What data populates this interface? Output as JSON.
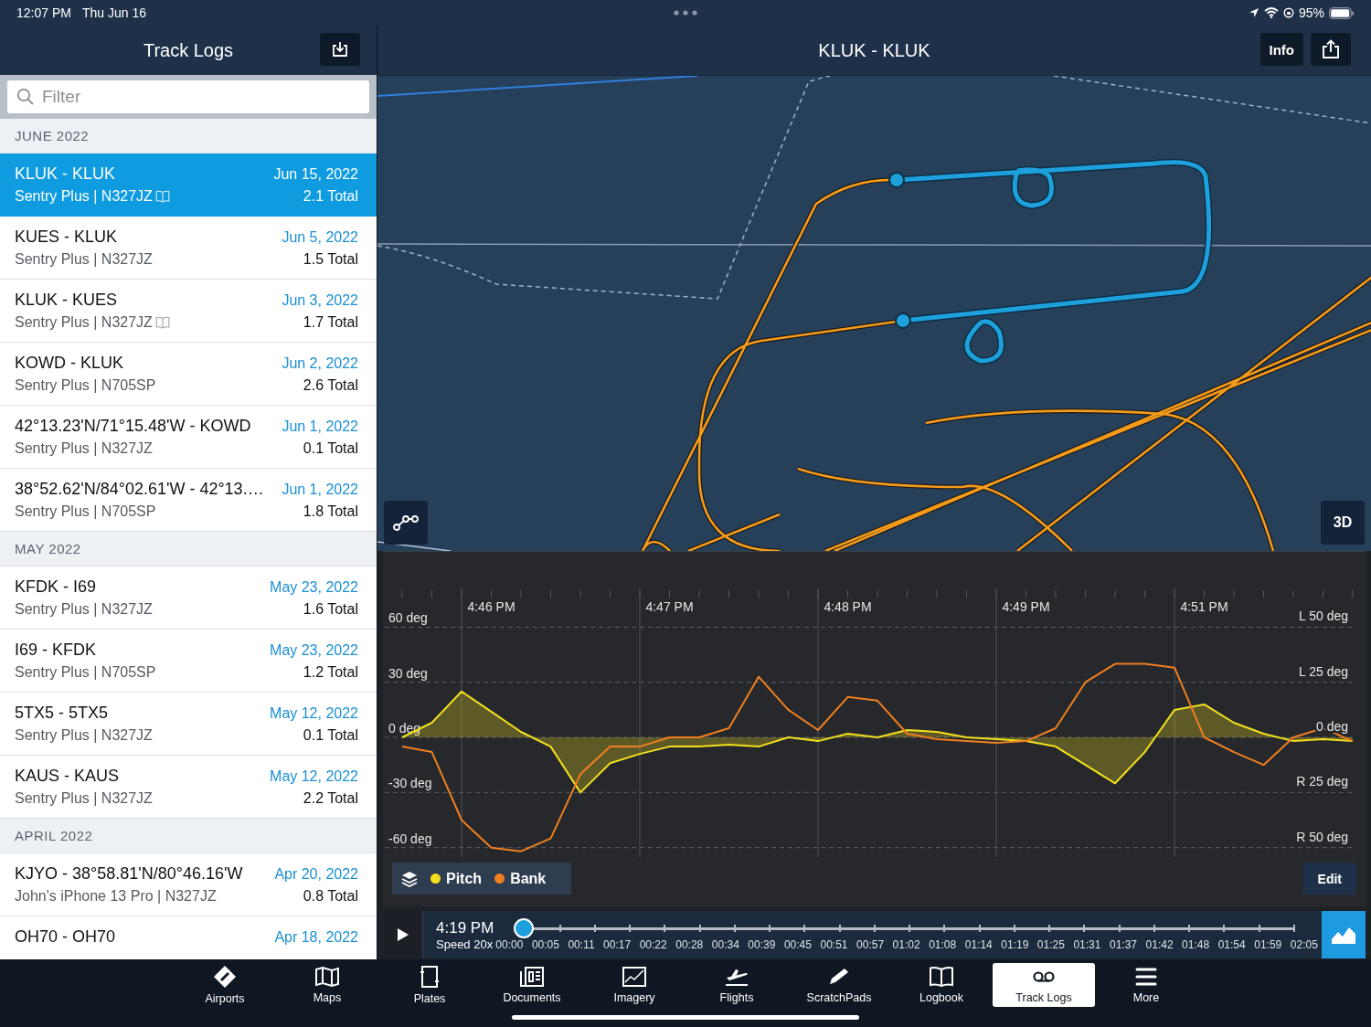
{
  "status_bar": {
    "time": "12:07 PM",
    "date": "Thu Jun 16",
    "battery": "95%"
  },
  "sidebar": {
    "title": "Track Logs",
    "search": {
      "placeholder": "Filter"
    },
    "sections": [
      {
        "heading": "JUNE 2022",
        "items": [
          {
            "title": "KLUK - KLUK",
            "subtitle": "Sentry Plus | N327JZ",
            "logbook": true,
            "date": "Jun 15, 2022",
            "total": "2.1 Total",
            "selected": true
          },
          {
            "title": "KUES - KLUK",
            "subtitle": "Sentry Plus | N327JZ",
            "logbook": false,
            "date": "Jun 5, 2022",
            "total": "1.5 Total",
            "selected": false
          },
          {
            "title": "KLUK - KUES",
            "subtitle": "Sentry Plus | N327JZ",
            "logbook": true,
            "date": "Jun 3, 2022",
            "total": "1.7 Total",
            "selected": false
          },
          {
            "title": "KOWD - KLUK",
            "subtitle": "Sentry Plus | N705SP",
            "logbook": false,
            "date": "Jun 2, 2022",
            "total": "2.6 Total",
            "selected": false
          },
          {
            "title": "42°13.23'N/71°15.48'W - KOWD",
            "subtitle": "Sentry Plus | N327JZ",
            "logbook": false,
            "date": "Jun 1, 2022",
            "total": "0.1 Total",
            "selected": false
          },
          {
            "title": "38°52.62'N/84°02.61'W - 42°13.…",
            "subtitle": "Sentry Plus | N705SP",
            "logbook": false,
            "date": "Jun 1, 2022",
            "total": "1.8 Total",
            "selected": false
          }
        ]
      },
      {
        "heading": "MAY 2022",
        "items": [
          {
            "title": "KFDK - I69",
            "subtitle": "Sentry Plus | N327JZ",
            "logbook": false,
            "date": "May 23, 2022",
            "total": "1.6 Total",
            "selected": false
          },
          {
            "title": "I69 - KFDK",
            "subtitle": "Sentry Plus | N705SP",
            "logbook": false,
            "date": "May 23, 2022",
            "total": "1.2 Total",
            "selected": false
          },
          {
            "title": "5TX5 - 5TX5",
            "subtitle": "Sentry Plus | N327JZ",
            "logbook": false,
            "date": "May 12, 2022",
            "total": "0.1 Total",
            "selected": false
          },
          {
            "title": "KAUS - KAUS",
            "subtitle": "Sentry Plus | N327JZ",
            "logbook": false,
            "date": "May 12, 2022",
            "total": "2.2 Total",
            "selected": false
          }
        ]
      },
      {
        "heading": "APRIL 2022",
        "items": [
          {
            "title": "KJYO - 38°58.81'N/80°46.16'W",
            "subtitle": "John's iPhone 13 Pro | N327JZ",
            "logbook": false,
            "date": "Apr 20, 2022",
            "total": "0.8 Total",
            "selected": false
          },
          {
            "title": "OH70 - OH70",
            "date": "Apr 18, 2022",
            "selected": false
          }
        ]
      }
    ]
  },
  "detail": {
    "title": "KLUK - KLUK",
    "info_button": "Info",
    "map_mode_button": "3D",
    "chart_panel": {
      "chart_data": {
        "type": "line",
        "categories": [
          null,
          null,
          null,
          "4:46 PM",
          null,
          null,
          null,
          null,
          null,
          "4:47 PM",
          null,
          null,
          null,
          null,
          null,
          "4:48 PM",
          null,
          null,
          null,
          null,
          null,
          "4:49 PM",
          null,
          null,
          null,
          null,
          null,
          "4:51 PM",
          null,
          null,
          null,
          null,
          null
        ],
        "series": [
          {
            "name": "Pitch",
            "color": "#f2e01d",
            "values": [
              0,
              8,
              25,
              14,
              3,
              -5,
              -30,
              -14,
              -9,
              -5,
              -5,
              -4,
              -5,
              0,
              -2,
              2,
              0,
              4,
              3,
              0,
              -1,
              -2,
              -5,
              -15,
              -25,
              -8,
              15,
              18,
              8,
              2,
              -2,
              -1,
              -2
            ]
          },
          {
            "name": "Bank",
            "color": "#f07f1f",
            "values": [
              -5,
              -8,
              -45,
              -60,
              -62,
              -55,
              -20,
              -5,
              -5,
              0,
              0,
              5,
              33,
              15,
              4,
              22,
              20,
              2,
              -1,
              -2,
              -3,
              -2,
              5,
              30,
              40,
              40,
              38,
              0,
              -8,
              -15,
              0,
              5,
              -2
            ]
          }
        ],
        "grid": true,
        "ylim": [
          -92,
          101
        ],
        "yticks": [
          {
            "value": 60,
            "label": "60 deg"
          },
          {
            "value": 30,
            "label": "30 deg"
          },
          {
            "value": 0,
            "label": "0 deg"
          },
          {
            "value": -30,
            "label": "-30 deg"
          },
          {
            "value": -60,
            "label": "-60 deg"
          }
        ]
      },
      "right_axis_labels": [
        "L 50 deg",
        "L 25 deg",
        "0 deg",
        "R 25 deg",
        "R 50 deg"
      ],
      "edit_button": "Edit"
    },
    "playback": {
      "time": "4:19 PM",
      "speed": "Speed 20x",
      "level": 0,
      "ticks": [
        "00:00",
        "00:05",
        "00:11",
        "00:17",
        "00:22",
        "00:28",
        "00:34",
        "00:39",
        "00:45",
        "00:51",
        "00:57",
        "01:02",
        "01:08",
        "01:14",
        "01:19",
        "01:25",
        "01:31",
        "01:37",
        "01:42",
        "01:48",
        "01:54",
        "01:59",
        "02:05"
      ]
    }
  },
  "tab_bar": [
    {
      "label": "Airports",
      "selected": false
    },
    {
      "label": "Maps",
      "selected": false
    },
    {
      "label": "Plates",
      "selected": false
    },
    {
      "label": "Documents",
      "selected": false
    },
    {
      "label": "Imagery",
      "selected": false
    },
    {
      "label": "Flights",
      "selected": false
    },
    {
      "label": "ScratchPads",
      "selected": false
    },
    {
      "label": "Logbook",
      "selected": false
    },
    {
      "label": "Track Logs",
      "selected": true
    },
    {
      "label": "More",
      "selected": false
    }
  ]
}
